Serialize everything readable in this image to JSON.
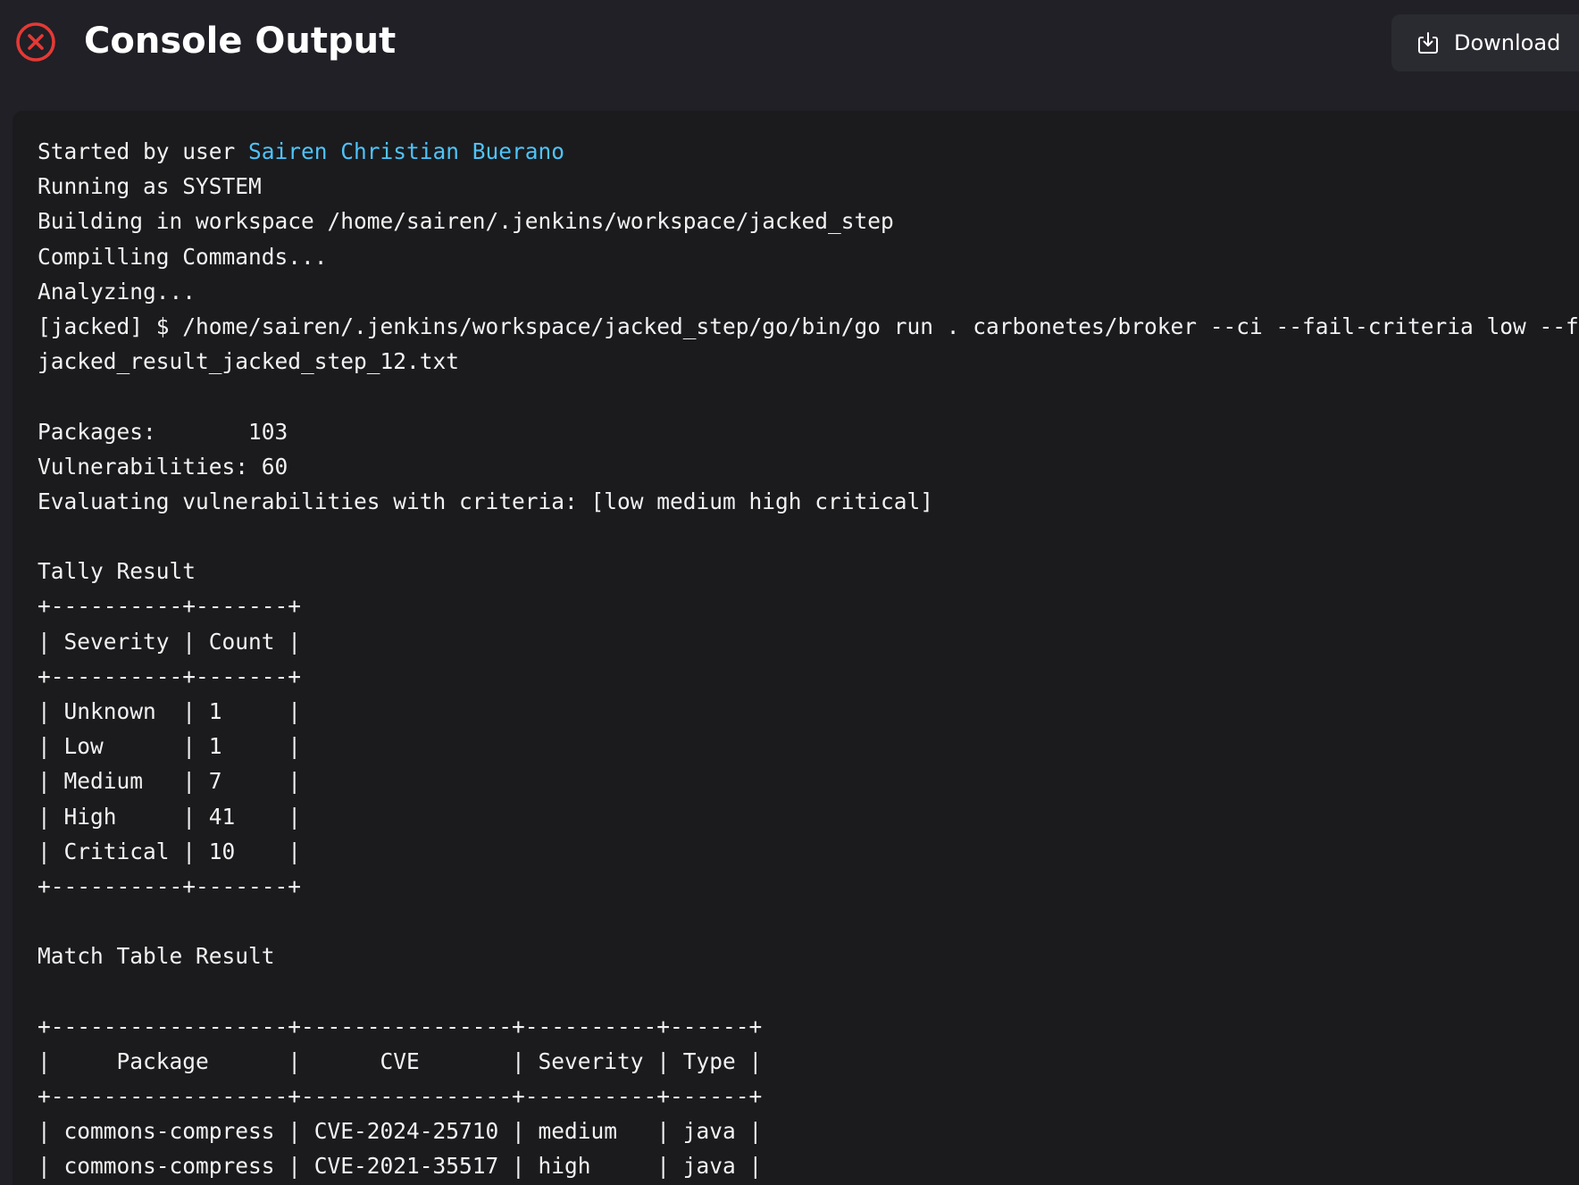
{
  "header": {
    "title": "Console Output",
    "status_icon": "failure-x-circle-icon",
    "status_color": "#e53935",
    "download_label": "Download",
    "download_icon": "download-icon"
  },
  "console": {
    "started_prefix": "Started by user ",
    "user_name": "Sairen Christian Buerano",
    "link_color": "#4fc3f7",
    "lines": [
      "Running as SYSTEM",
      "Building in workspace /home/sairen/.jenkins/workspace/jacked_step",
      "Compilling Commands...",
      "Analyzing...",
      "[jacked] $ /home/sairen/.jenkins/workspace/jacked_step/go/bin/go run . carbonetes/broker --ci --fail-criteria low --file",
      "jacked_result_jacked_step_12.txt",
      "",
      "Packages:       103",
      "Vulnerabilities: 60",
      "Evaluating vulnerabilities with criteria: [low medium high critical]",
      "",
      "Tally Result",
      "+----------+-------+",
      "| Severity | Count |",
      "+----------+-------+",
      "| Unknown  | 1     |",
      "| Low      | 1     |",
      "| Medium   | 7     |",
      "| High     | 41    |",
      "| Critical | 10    |",
      "+----------+-------+",
      "",
      "Match Table Result",
      "",
      "+------------------+----------------+----------+------+",
      "|     Package      |      CVE       | Severity | Type |",
      "+------------------+----------------+----------+------+",
      "| commons-compress | CVE-2024-25710 | medium   | java |",
      "| commons-compress | CVE-2021-35517 | high     | java |"
    ]
  }
}
